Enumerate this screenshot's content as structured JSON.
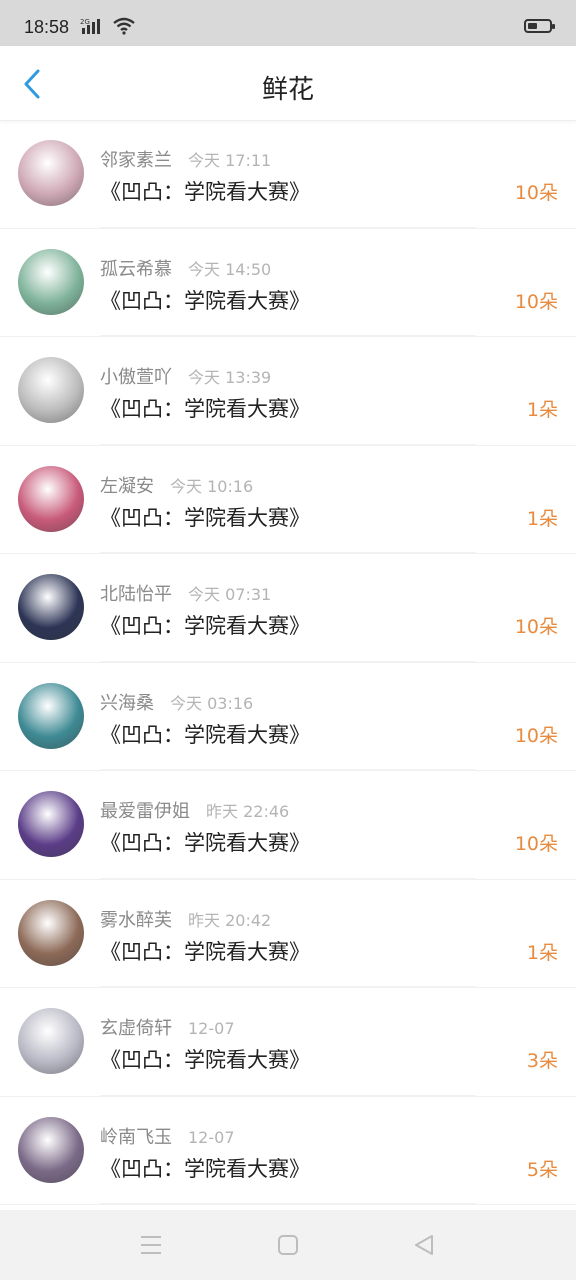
{
  "status": {
    "time": "18:58",
    "network": "2G"
  },
  "header": {
    "title": "鲜花"
  },
  "items": [
    {
      "name": "邻家素兰",
      "time": "今天 17:11",
      "work": "《凹凸：学院看大赛》",
      "count": "10朵",
      "avatar_color": "#cfa8b6"
    },
    {
      "name": "孤云希慕",
      "time": "今天 14:50",
      "work": "《凹凸：学院看大赛》",
      "count": "10朵",
      "avatar_color": "#7fb39a"
    },
    {
      "name": "小傲萱吖",
      "time": "今天 13:39",
      "work": "《凹凸：学院看大赛》",
      "count": "1朵",
      "avatar_color": "#bcbcbc"
    },
    {
      "name": "左凝安",
      "time": "今天 10:16",
      "work": "《凹凸：学院看大赛》",
      "count": "1朵",
      "avatar_color": "#c85a7a"
    },
    {
      "name": "北陆怡平",
      "time": "今天 07:31",
      "work": "《凹凸：学院看大赛》",
      "count": "10朵",
      "avatar_color": "#2d3556"
    },
    {
      "name": "兴海桑",
      "time": "今天 03:16",
      "work": "《凹凸：学院看大赛》",
      "count": "10朵",
      "avatar_color": "#3e8a94"
    },
    {
      "name": "最爱雷伊姐",
      "time": "昨天 22:46",
      "work": "《凹凸：学院看大赛》",
      "count": "10朵",
      "avatar_color": "#5b3d88"
    },
    {
      "name": "雾水醉芙",
      "time": "昨天 20:42",
      "work": "《凹凸：学院看大赛》",
      "count": "1朵",
      "avatar_color": "#8d6a58"
    },
    {
      "name": "玄虚倚轩",
      "time": "12-07",
      "work": "《凹凸：学院看大赛》",
      "count": "3朵",
      "avatar_color": "#b9b9c6"
    },
    {
      "name": "岭南飞玉",
      "time": "12-07",
      "work": "《凹凸：学院看大赛》",
      "count": "5朵",
      "avatar_color": "#7b6a88"
    }
  ]
}
